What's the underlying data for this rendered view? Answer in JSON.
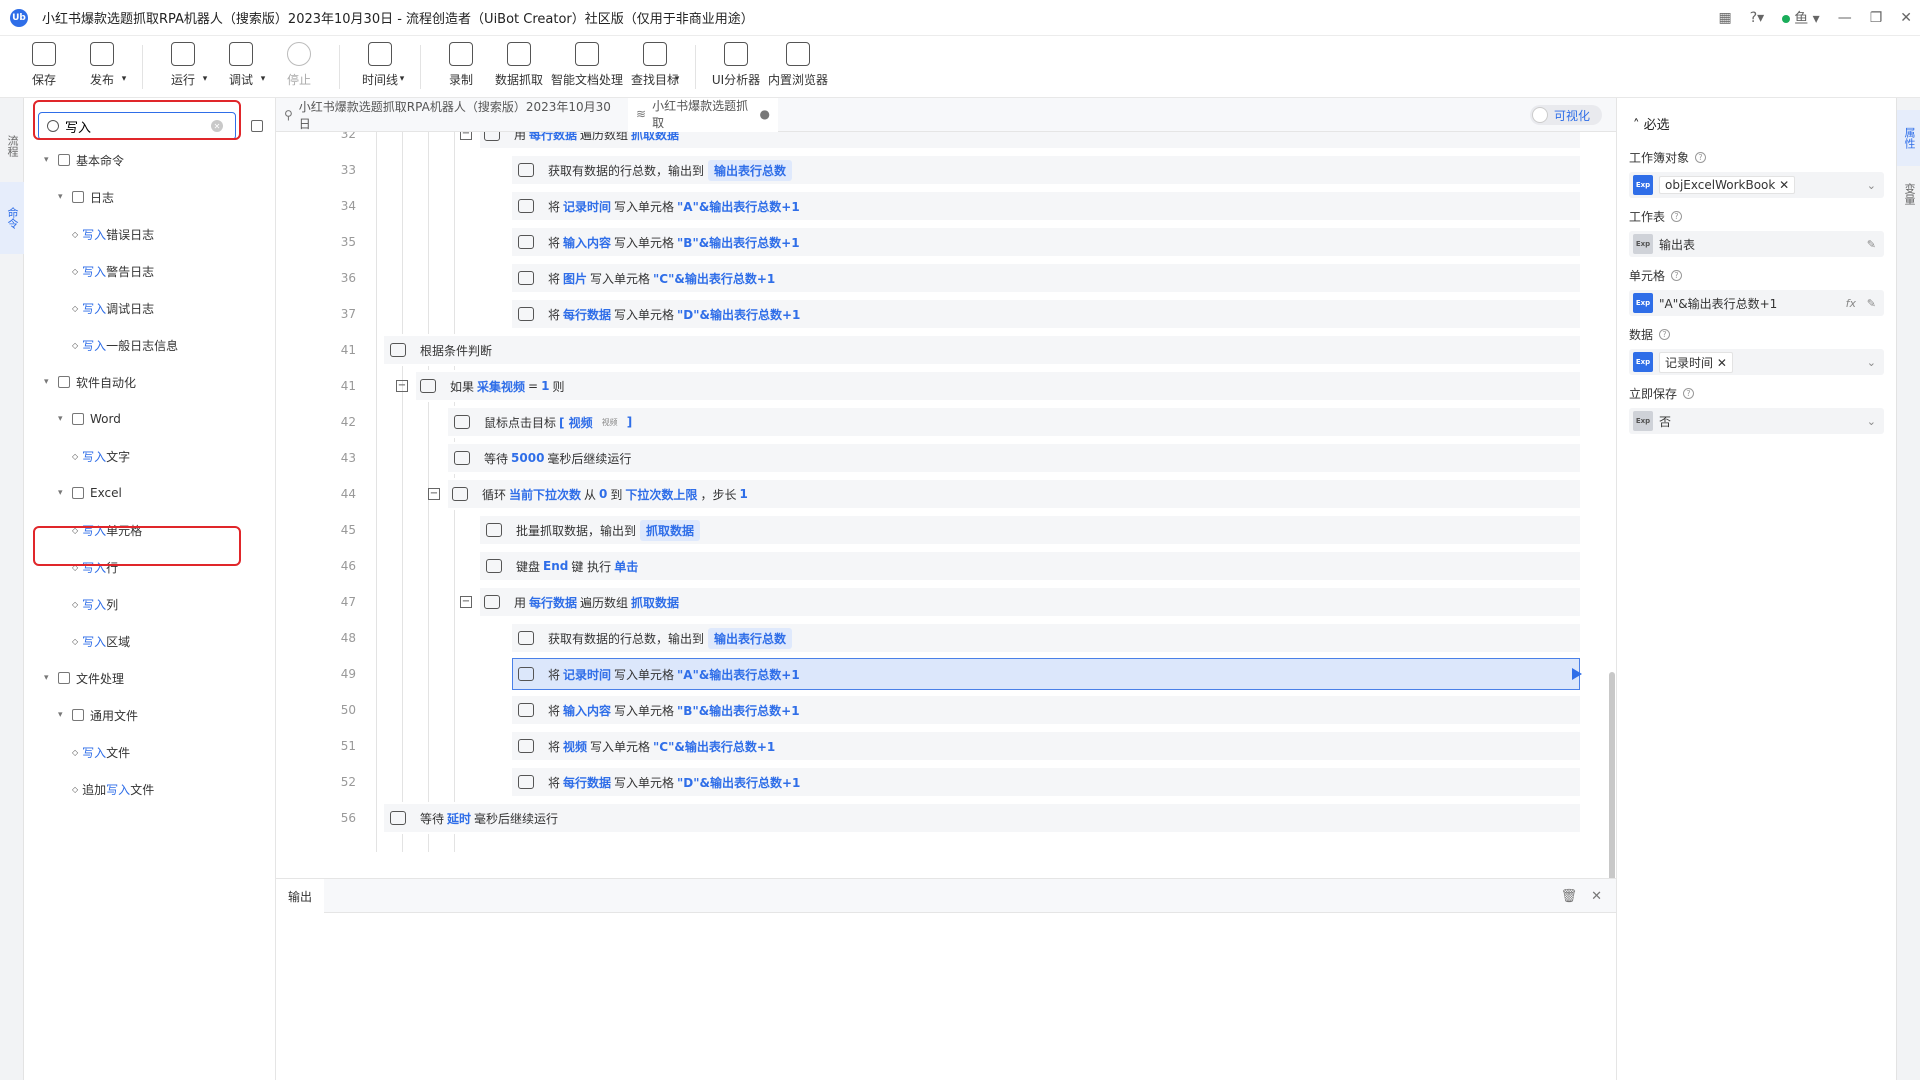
{
  "window": {
    "logo": "Ub",
    "title": "小红书爆款选题抓取RPA机器人（搜索版）2023年10月30日 - 流程创造者（UiBot Creator）社区版（仅用于非商业用途）",
    "user": "鱼"
  },
  "toolbar": {
    "items": [
      {
        "label": "保存",
        "icon": "save-icon"
      },
      {
        "label": "发布",
        "icon": "send-icon",
        "dropdown": true
      },
      {
        "label": "运行",
        "icon": "run-icon",
        "dropdown": true
      },
      {
        "label": "调试",
        "icon": "debug-icon",
        "dropdown": true
      },
      {
        "label": "停止",
        "icon": "stop-icon",
        "disabled": true
      },
      {
        "label": "时间线",
        "icon": "timeline-icon",
        "dropdown": true
      },
      {
        "label": "录制",
        "icon": "record-icon"
      },
      {
        "label": "数据抓取",
        "icon": "data-scrape-icon"
      },
      {
        "label": "智能文档处理",
        "icon": "ai-doc-icon"
      },
      {
        "label": "查找目标",
        "icon": "find-target-icon",
        "dropdown": true
      },
      {
        "label": "UI分析器",
        "icon": "ui-analyzer-icon"
      },
      {
        "label": "内置浏览器",
        "icon": "browser-icon"
      }
    ]
  },
  "leftrail": {
    "tab1": "流程",
    "tab2": "命令"
  },
  "search": {
    "value": "写入"
  },
  "tree": [
    {
      "text": "基本命令",
      "level": 0
    },
    {
      "text": "日志",
      "level": 1
    },
    {
      "pre": "",
      "hit": "写入",
      "post": "错误日志",
      "level": 2
    },
    {
      "pre": "",
      "hit": "写入",
      "post": "警告日志",
      "level": 2
    },
    {
      "pre": "",
      "hit": "写入",
      "post": "调试日志",
      "level": 2
    },
    {
      "pre": "",
      "hit": "写入",
      "post": "一般日志信息",
      "level": 2
    },
    {
      "text": "软件自动化",
      "level": 0
    },
    {
      "text": "Word",
      "level": 1
    },
    {
      "pre": "",
      "hit": "写入",
      "post": "文字",
      "level": 2
    },
    {
      "text": "Excel",
      "level": 1
    },
    {
      "pre": "",
      "hit": "写入",
      "post": "单元格",
      "level": 2
    },
    {
      "pre": "",
      "hit": "写入",
      "post": "行",
      "level": 2
    },
    {
      "pre": "",
      "hit": "写入",
      "post": "列",
      "level": 2
    },
    {
      "pre": "",
      "hit": "写入",
      "post": "区域",
      "level": 2
    },
    {
      "text": "文件处理",
      "level": 0
    },
    {
      "text": "通用文件",
      "level": 1
    },
    {
      "pre": "",
      "hit": "写入",
      "post": "文件",
      "level": 2
    },
    {
      "pre": "追加",
      "hit": "写入",
      "post": "文件",
      "level": 2
    }
  ],
  "editor": {
    "tab1": "小红书爆款选题抓取RPA机器人（搜索版）2023年10月30日",
    "tab2": "小红书爆款选题抓取",
    "visual_toggle": "可视化"
  },
  "code": [
    {
      "n": "32",
      "indent": 3,
      "toggle": "−",
      "parts": [
        [
          "用 ",
          ""
        ],
        [
          "每行数据",
          "k"
        ],
        [
          " 遍历数组 ",
          ""
        ],
        [
          "抓取数据",
          "k"
        ]
      ]
    },
    {
      "n": "33",
      "indent": 4,
      "parts": [
        [
          "获取有数据的行总数，输出到 ",
          ""
        ],
        [
          "输出表行总数",
          "pill"
        ]
      ]
    },
    {
      "n": "34",
      "indent": 4,
      "parts": [
        [
          "将 ",
          ""
        ],
        [
          "记录时间",
          "k"
        ],
        [
          " 写入单元格 ",
          ""
        ],
        [
          "\"A\"&输出表行总数+1",
          "k"
        ]
      ]
    },
    {
      "n": "35",
      "indent": 4,
      "parts": [
        [
          "将 ",
          ""
        ],
        [
          "输入内容",
          "k"
        ],
        [
          " 写入单元格 ",
          ""
        ],
        [
          "\"B\"&输出表行总数+1",
          "k"
        ]
      ]
    },
    {
      "n": "36",
      "indent": 4,
      "parts": [
        [
          "将 ",
          ""
        ],
        [
          "图片",
          "k"
        ],
        [
          " 写入单元格 ",
          ""
        ],
        [
          "\"C\"&输出表行总数+1",
          "k"
        ]
      ]
    },
    {
      "n": "37",
      "indent": 4,
      "parts": [
        [
          "将 ",
          ""
        ],
        [
          "每行数据",
          "k"
        ],
        [
          " 写入单元格 ",
          ""
        ],
        [
          "\"D\"&输出表行总数+1",
          "k"
        ]
      ]
    },
    {
      "n": "41",
      "indent": 0,
      "parts": [
        [
          "根据条件判断",
          ""
        ]
      ]
    },
    {
      "n": "41",
      "indent": 1,
      "toggle": "−",
      "parts": [
        [
          "如果 ",
          ""
        ],
        [
          "采集视频",
          "k"
        ],
        [
          " = ",
          ""
        ],
        [
          "1",
          "k"
        ],
        [
          " 则",
          ""
        ]
      ]
    },
    {
      "n": "42",
      "indent": 2,
      "parts": [
        [
          "鼠标点击目标 ",
          ""
        ],
        [
          "[ 视频",
          "k"
        ],
        [
          "视频",
          "tiny"
        ],
        [
          "]",
          "k"
        ]
      ]
    },
    {
      "n": "43",
      "indent": 2,
      "parts": [
        [
          "等待 ",
          ""
        ],
        [
          "5000",
          "k"
        ],
        [
          " 毫秒后继续运行",
          ""
        ]
      ]
    },
    {
      "n": "44",
      "indent": 2,
      "toggle": "−",
      "parts": [
        [
          "循环 ",
          ""
        ],
        [
          "当前下拉次数",
          "k"
        ],
        [
          " 从 ",
          ""
        ],
        [
          "0",
          "k"
        ],
        [
          " 到 ",
          ""
        ],
        [
          "下拉次数上限",
          "k"
        ],
        [
          " ，步长 ",
          ""
        ],
        [
          "1",
          "k"
        ]
      ]
    },
    {
      "n": "45",
      "indent": 3,
      "parts": [
        [
          "批量抓取数据，输出到 ",
          ""
        ],
        [
          "抓取数据",
          "pill"
        ]
      ]
    },
    {
      "n": "46",
      "indent": 3,
      "parts": [
        [
          "键盘 ",
          ""
        ],
        [
          "End",
          "k"
        ],
        [
          " 键 执行 ",
          ""
        ],
        [
          "单击",
          "k"
        ]
      ]
    },
    {
      "n": "47",
      "indent": 3,
      "toggle": "−",
      "parts": [
        [
          "用 ",
          ""
        ],
        [
          "每行数据",
          "k"
        ],
        [
          " 遍历数组 ",
          ""
        ],
        [
          "抓取数据",
          "k"
        ]
      ]
    },
    {
      "n": "48",
      "indent": 4,
      "parts": [
        [
          "获取有数据的行总数，输出到 ",
          ""
        ],
        [
          "输出表行总数",
          "pill"
        ]
      ]
    },
    {
      "n": "49",
      "indent": 4,
      "selected": true,
      "parts": [
        [
          "将 ",
          ""
        ],
        [
          "记录时间",
          "k"
        ],
        [
          " 写入单元格 ",
          ""
        ],
        [
          "\"A\"&输出表行总数+1",
          "k"
        ]
      ]
    },
    {
      "n": "50",
      "indent": 4,
      "parts": [
        [
          "将 ",
          ""
        ],
        [
          "输入内容",
          "k"
        ],
        [
          " 写入单元格 ",
          ""
        ],
        [
          "\"B\"&输出表行总数+1",
          "k"
        ]
      ]
    },
    {
      "n": "51",
      "indent": 4,
      "parts": [
        [
          "将 ",
          ""
        ],
        [
          "视频",
          "k"
        ],
        [
          " 写入单元格 ",
          ""
        ],
        [
          "\"C\"&输出表行总数+1",
          "k"
        ]
      ]
    },
    {
      "n": "52",
      "indent": 4,
      "parts": [
        [
          "将 ",
          ""
        ],
        [
          "每行数据",
          "k"
        ],
        [
          " 写入单元格 ",
          ""
        ],
        [
          "\"D\"&输出表行总数+1",
          "k"
        ]
      ]
    },
    {
      "n": "56",
      "indent": 0,
      "parts": [
        [
          "等待 ",
          ""
        ],
        [
          "延时",
          "k"
        ],
        [
          " 毫秒后继续运行",
          ""
        ]
      ]
    }
  ],
  "output": {
    "tab": "输出"
  },
  "props": {
    "section": "必选",
    "workbook_label": "工作簿对象",
    "workbook_value": "objExcelWorkBook",
    "sheet_label": "工作表",
    "sheet_value": "输出表",
    "cell_label": "单元格",
    "cell_value": "\"A\"&输出表行总数+1",
    "data_label": "数据",
    "data_value": "记录时间",
    "save_label": "立即保存",
    "save_value": "否",
    "exp": "Exp",
    "fx": "fx"
  },
  "rightrail": {
    "tab1": "属性",
    "tab2": "变量"
  }
}
